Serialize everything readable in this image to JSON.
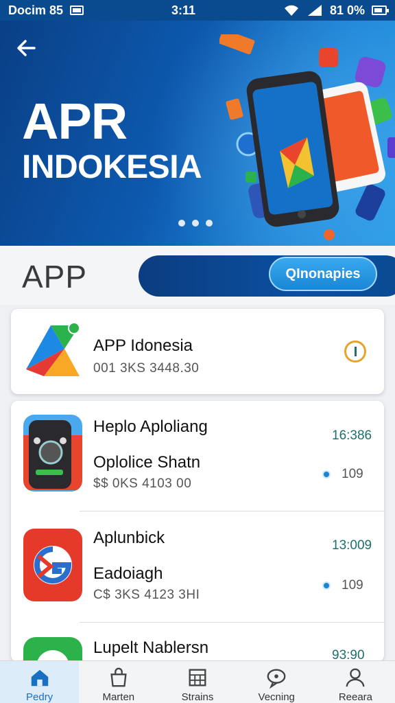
{
  "status_bar": {
    "left_text": "Docim 85",
    "time": "3:11",
    "battery_text": "81 0%"
  },
  "hero": {
    "title_line1": "APR",
    "title_line2": "INDOKESIA"
  },
  "section": {
    "label": "APP",
    "pill_button": "QInonapies"
  },
  "featured": {
    "title": "APP Idonesia",
    "subtitle": "001 3KS 3448.30"
  },
  "list": [
    {
      "title": "Heplo Aploliang",
      "subtitle": "Oplolice Shatn",
      "meta": "$$ 0KS 4103 00",
      "time": "16:386",
      "count": "109"
    },
    {
      "title": "Aplunbick",
      "subtitle": "Eadoiagh",
      "meta": "C$ 3KS 4123 3HI",
      "time": "13:009",
      "count": "109"
    },
    {
      "title": "Lupelt Nablersn",
      "time": "93:90"
    }
  ],
  "bottom_nav": [
    {
      "label": "Pedry",
      "icon": "home-icon"
    },
    {
      "label": "Marten",
      "icon": "bag-icon"
    },
    {
      "label": "Strains",
      "icon": "grid-icon"
    },
    {
      "label": "Vecning",
      "icon": "chat-icon"
    },
    {
      "label": "Reeara",
      "icon": "profile-icon"
    }
  ],
  "colors": {
    "primary": "#0b4fa0",
    "accent": "#1a86d6",
    "time_text": "#1c6f6a"
  }
}
